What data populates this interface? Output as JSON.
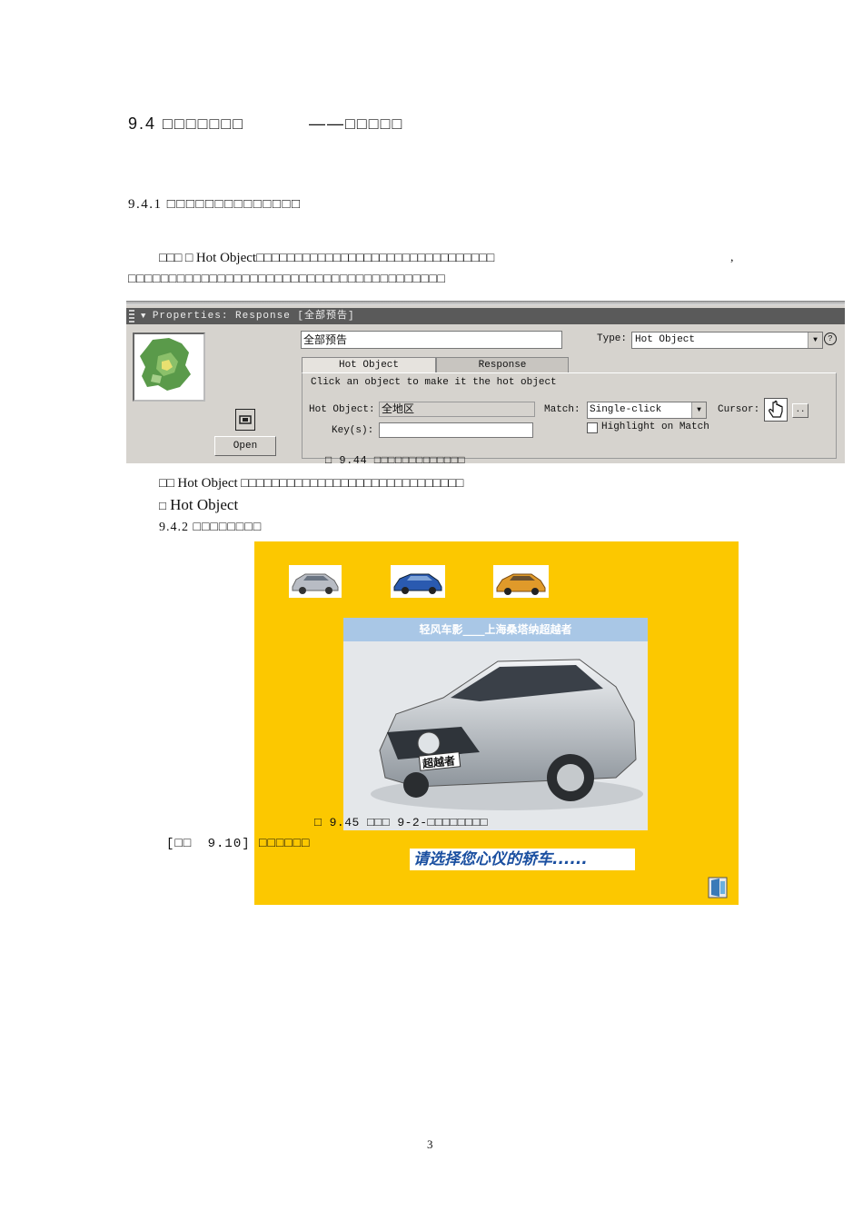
{
  "heading": {
    "number": "9.4",
    "left": "□□□□□□□",
    "dash": "——",
    "right": "□□□□□"
  },
  "subheading_1": "9.4.1 □□□□□□□□□□□□□□",
  "para_1": {
    "indent": "□□□",
    "mark": "□",
    "keyword": "Hot Object",
    "text": "□□□□□□□□□□□□□□□□□□□□□□□□□□□□□□□",
    "comma": ","
  },
  "para_2": "□□□□□□□□□□□□□□□□□□□□□□□□□□□□□□□□□□□□□□□",
  "properties_panel": {
    "title": "Properties: Response [全部预告]",
    "name_value": "全部预告",
    "type_label": "Type:",
    "type_value": "Hot Object",
    "open_button": "Open",
    "tabs": [
      {
        "label": "Hot Object"
      },
      {
        "label": "Response"
      }
    ],
    "instruction": "Click an object to make it the hot object",
    "hot_object_label": "Hot Object:",
    "hot_object_value": "全地区",
    "key_label": "Key(s):",
    "key_value": "",
    "match_label": "Match:",
    "match_value": "Single-click",
    "cursor_label": "Cursor:",
    "cursor_more": "..",
    "highlight_label": "Highlight on Match",
    "highlight_checked": false,
    "caption": "□ 9.44 □□□□□□□□□□□□□"
  },
  "para_3": {
    "mark": "□□",
    "keyword": "Hot Object",
    "text": "□□□□□□□□□□□□□□□□□□□□□□□□□□□□□"
  },
  "para_4": {
    "mark": "□",
    "keyword": "Hot Object"
  },
  "subheading_2": "9.4.2 □□□□□□□□",
  "demo_window": {
    "banner": "轻风车影____上海桑塔纳超越者",
    "car_badge": "超越者",
    "caption": "□ 9.45 □□□ 9-2-□□□□□□□□",
    "prompt": "请选择您心仪的轿车......"
  },
  "example_note": {
    "bracket": "[□□",
    "num": "9.10]",
    "text": "□□□□□□"
  },
  "page_number": "3",
  "colors": {
    "demo_background": "#fcc800",
    "panel_title_bar": "#5a5a5a",
    "banner": "#a9c7e6",
    "prompt_text": "#1a4fa0"
  }
}
